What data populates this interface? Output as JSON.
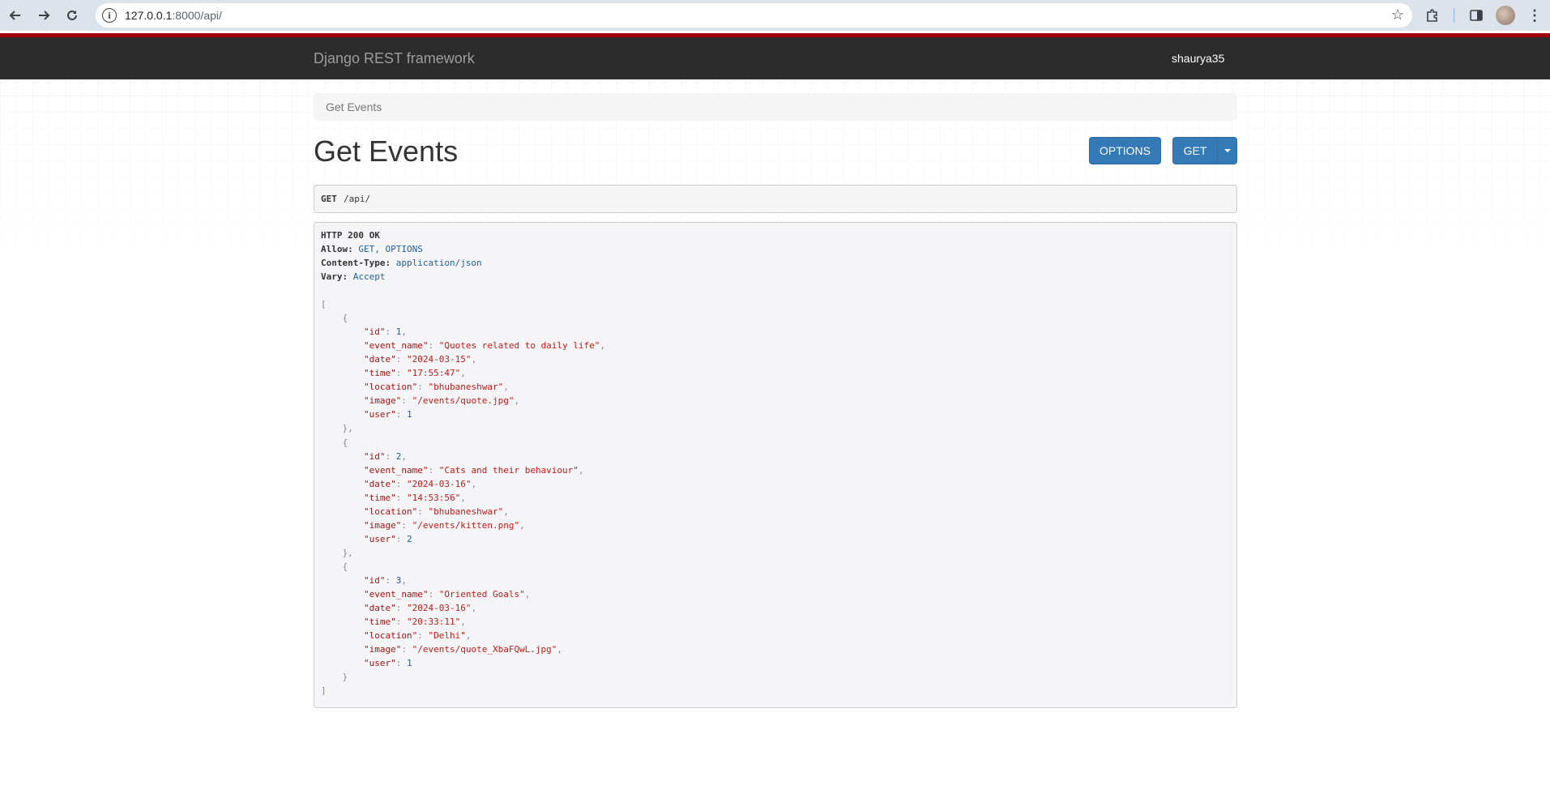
{
  "browser": {
    "url_host": "127.0.0.1",
    "url_rest": ":8000/api/"
  },
  "navbar": {
    "brand": "Django REST framework",
    "username": "shaurya35"
  },
  "breadcrumb": {
    "item": "Get Events"
  },
  "page": {
    "title": "Get Events",
    "options_button": "OPTIONS",
    "get_button": "GET"
  },
  "request": {
    "method": "GET",
    "path": "/api/"
  },
  "response": {
    "status": "HTTP 200 OK",
    "headers": [
      {
        "key": "Allow:",
        "value": "GET, OPTIONS"
      },
      {
        "key": "Content-Type:",
        "value": "application/json"
      },
      {
        "key": "Vary:",
        "value": "Accept"
      }
    ],
    "events": [
      {
        "id": "1",
        "event_name": "\"Quotes related to daily life\"",
        "date": "\"2024-03-15\"",
        "time": "\"17:55:47\"",
        "location": "\"bhubaneshwar\"",
        "image": "\"/events/quote.jpg\"",
        "user": "1"
      },
      {
        "id": "2",
        "event_name": "\"Cats and their behaviour\"",
        "date": "\"2024-03-16\"",
        "time": "\"14:53:56\"",
        "location": "\"bhubaneshwar\"",
        "image": "\"/events/kitten.png\"",
        "user": "2"
      },
      {
        "id": "3",
        "event_name": "\"Oriented Goals\"",
        "date": "\"2024-03-16\"",
        "time": "\"20:33:11\"",
        "location": "\"Delhi\"",
        "image": "\"/events/quote_XbaFQwL.jpg\"",
        "user": "1"
      }
    ]
  },
  "colors": {
    "navbar_bg": "#2c2c2c",
    "accent_red": "#a30000",
    "button_blue": "#337ab7",
    "json_string": "#c41a16",
    "json_number": "#1f5f9e"
  }
}
